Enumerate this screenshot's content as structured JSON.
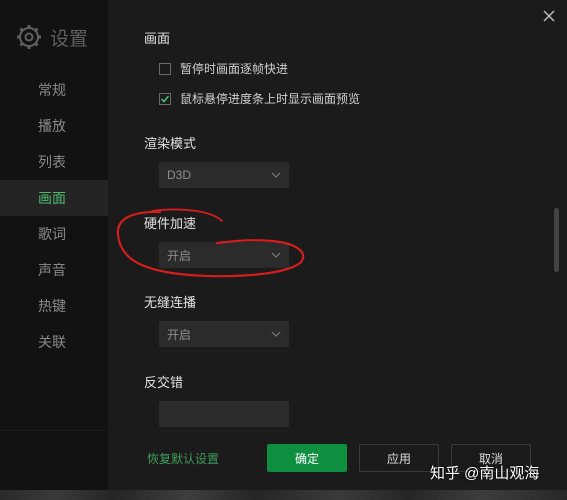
{
  "sidebar": {
    "title": "设置",
    "items": [
      {
        "label": "常规"
      },
      {
        "label": "播放"
      },
      {
        "label": "列表"
      },
      {
        "label": "画面"
      },
      {
        "label": "歌词"
      },
      {
        "label": "声音"
      },
      {
        "label": "热键"
      },
      {
        "label": "关联"
      }
    ],
    "active_index": 3
  },
  "main": {
    "picture_section": {
      "title": "画面",
      "options": [
        {
          "label": "暂停时画面逐帧快进",
          "checked": false
        },
        {
          "label": "鼠标悬停进度条上时显示画面预览",
          "checked": true
        }
      ]
    },
    "render_mode": {
      "title": "渲染模式",
      "value": "D3D"
    },
    "hw_accel": {
      "title": "硬件加速",
      "value": "开启"
    },
    "no_gap": {
      "title": "无缝连播",
      "value": "开启"
    },
    "anti_alias": {
      "title": "反交错"
    }
  },
  "footer": {
    "restore_label": "恢复默认设置",
    "ok_label": "确定",
    "apply_label": "应用",
    "cancel_label": "取消"
  },
  "watermark": "知乎 @南山观海",
  "colors": {
    "accent": "#4cb86b",
    "ok_button": "#0e8f3f",
    "annotation": "#d41e1e"
  }
}
